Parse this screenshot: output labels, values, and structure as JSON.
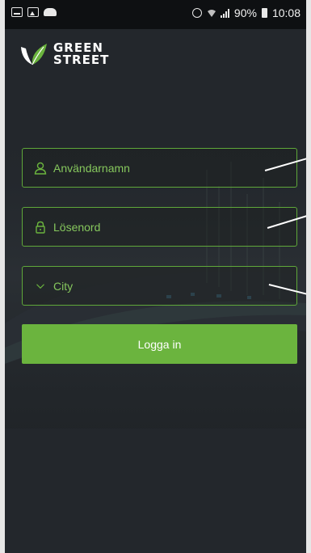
{
  "statusbar": {
    "left_icons": [
      "screenshot-icon",
      "gallery-icon",
      "weather-icon"
    ],
    "battery": "90%",
    "time": "10:08"
  },
  "logo": {
    "line1": "GREEN",
    "line2": "STREET"
  },
  "form": {
    "username": {
      "placeholder": "Användarnamn",
      "value": ""
    },
    "password": {
      "placeholder": "Lösenord",
      "value": ""
    },
    "city": {
      "selected": "City"
    },
    "login_label": "Logga in"
  },
  "colors": {
    "accent": "#6bb43e",
    "field_text": "#86c75d",
    "background": "#23272c",
    "statusbar": "#0e1012"
  }
}
